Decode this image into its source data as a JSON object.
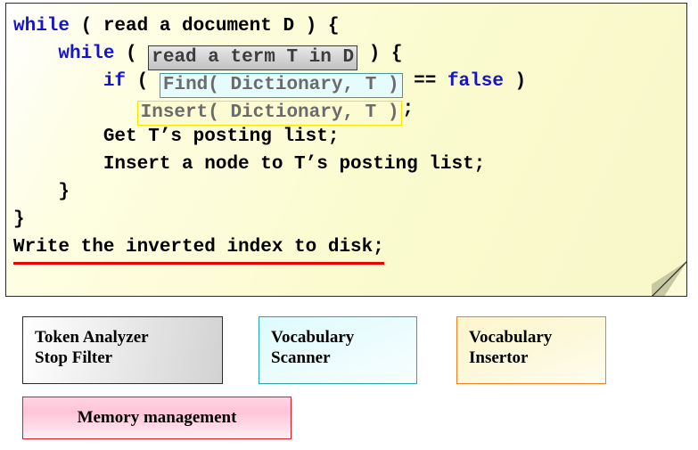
{
  "code_panel": {
    "lines": [
      {
        "id": "line-1",
        "segments": [
          {
            "text": "while",
            "style": "keyword"
          },
          {
            "text": " ( read a document D ) {",
            "style": "plain"
          }
        ]
      },
      {
        "id": "line-2",
        "segments": [
          {
            "text": "    ",
            "style": "plain"
          },
          {
            "text": "while",
            "style": "keyword"
          },
          {
            "text": " ( ",
            "style": "plain"
          },
          {
            "text": "read a term T in D",
            "style": "highlight-gray"
          },
          {
            "text": " ) {",
            "style": "plain"
          }
        ]
      },
      {
        "id": "line-3",
        "segments": [
          {
            "text": "        ",
            "style": "plain"
          },
          {
            "text": "if",
            "style": "keyword"
          },
          {
            "text": " ( ",
            "style": "plain"
          },
          {
            "text": "Find( Dictionary, T )",
            "style": "highlight-cyan"
          },
          {
            "text": " == ",
            "style": "plain"
          },
          {
            "text": "false",
            "style": "keyword"
          },
          {
            "text": " )",
            "style": "plain"
          }
        ]
      },
      {
        "id": "line-4",
        "segments": [
          {
            "text": "           ",
            "style": "plain"
          },
          {
            "text": "Insert( Dictionary, T )",
            "style": "highlight-yellow"
          },
          {
            "text": ";",
            "style": "plain"
          }
        ]
      },
      {
        "id": "line-5",
        "segments": [
          {
            "text": "        Get T’s posting list;",
            "style": "plain"
          }
        ]
      },
      {
        "id": "line-6",
        "segments": [
          {
            "text": "        Insert a node to T’s posting list;",
            "style": "plain"
          }
        ]
      },
      {
        "id": "line-7",
        "segments": [
          {
            "text": "    }",
            "style": "plain"
          }
        ]
      },
      {
        "id": "line-8",
        "segments": [
          {
            "text": "}",
            "style": "plain"
          }
        ]
      },
      {
        "id": "line-9",
        "segments": [
          {
            "text": "Write the inverted index to disk;",
            "style": "underline-red"
          }
        ]
      }
    ]
  },
  "components": {
    "token_analyzer": {
      "line1": "Token Analyzer",
      "line2": "Stop Filter"
    },
    "vocabulary_scanner": {
      "line1": "Vocabulary",
      "line2": "Scanner"
    },
    "vocabulary_insertor": {
      "line1": "Vocabulary",
      "line2": "Insertor"
    },
    "memory_management": {
      "label": "Memory management"
    }
  },
  "colors": {
    "keyword": "#1414cc",
    "panel_background": "#fbfbd8",
    "highlight_gray_border": "#3a3a3a",
    "highlight_cyan_border": "#3f9aa6",
    "highlight_yellow_border": "#f3e600",
    "underline_red": "#ee0000",
    "token_box_border": "#2b2b2b",
    "scanner_box_border": "#2aa3b0",
    "insertor_box_border": "#ef8024",
    "memory_box_border": "#e01b24"
  }
}
